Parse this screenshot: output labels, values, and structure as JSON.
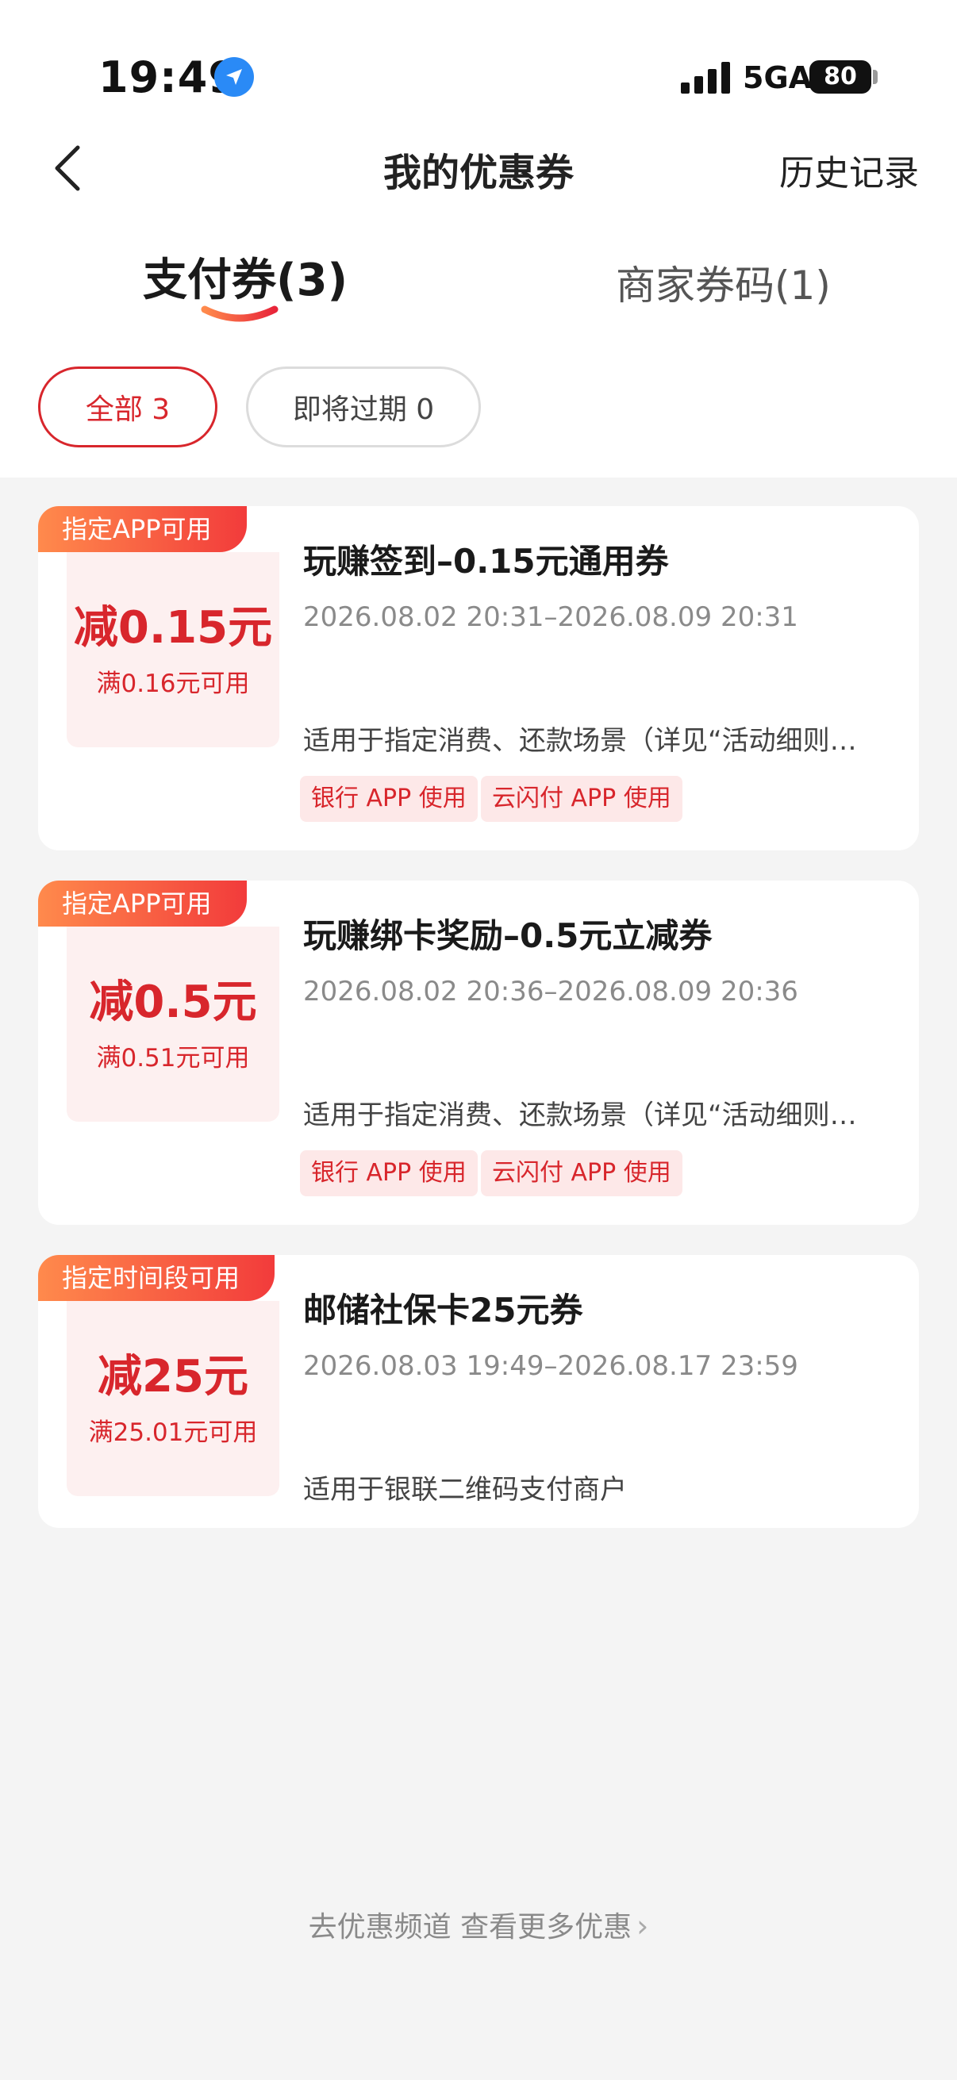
{
  "status_bar": {
    "time": "19:49",
    "network": "5GA",
    "battery": "80"
  },
  "header": {
    "title": "我的优惠券",
    "history": "历史记录"
  },
  "tabs": [
    {
      "label": "支付券(3)",
      "active": true
    },
    {
      "label": "商家券码(1)",
      "active": false
    }
  ],
  "filters": [
    {
      "label": "全部 3",
      "active": true
    },
    {
      "label": "即将过期 0",
      "active": false
    }
  ],
  "coupons": [
    {
      "ribbon": "指定APP可用",
      "amount": "减0.15元",
      "condition": "满0.16元可用",
      "name": "玩赚签到–0.15元通用券",
      "period": "2026.08.02 20:31–2026.08.09 20:31",
      "description": "适用于指定消费、还款场景（详见“活动细则…",
      "tags": [
        "银行 APP 使用",
        "云闪付 APP 使用"
      ]
    },
    {
      "ribbon": "指定APP可用",
      "amount": "减0.5元",
      "condition": "满0.51元可用",
      "name": "玩赚绑卡奖励–0.5元立减券",
      "period": "2026.08.02 20:36–2026.08.09 20:36",
      "description": "适用于指定消费、还款场景（详见“活动细则…",
      "tags": [
        "银行 APP 使用",
        "云闪付 APP 使用"
      ]
    },
    {
      "ribbon": "指定时间段可用",
      "amount": "减25元",
      "condition": "满25.01元可用",
      "name": "邮储社保卡25元券",
      "period": "2026.08.03 19:49–2026.08.17 23:59",
      "description": "适用于银联二维码支付商户",
      "tags": []
    }
  ],
  "footer": {
    "link": "去优惠频道 查看更多优惠"
  },
  "colors": {
    "accent": "#d8262c",
    "ribbon_start": "#ff8a4c",
    "ribbon_end": "#f23b3b",
    "tag_bg": "#fde8e8",
    "coupon_left_bg": "#fdf0f0"
  }
}
